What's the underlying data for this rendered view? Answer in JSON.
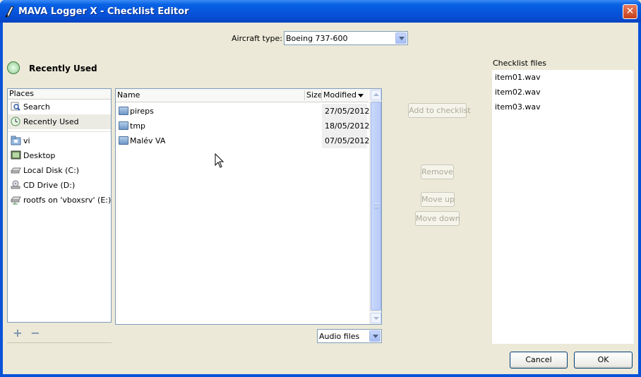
{
  "window": {
    "title": "MAVA Logger X - Checklist Editor",
    "close_glyph": "✕"
  },
  "aircraft": {
    "label": "Aircraft type:",
    "selected": "Boeing 737-600"
  },
  "recent_header": "Recently Used",
  "places": {
    "header": "Places",
    "items": [
      {
        "label": "Search",
        "icon": "search-icon"
      },
      {
        "label": "Recently Used",
        "icon": "recent-icon",
        "selected": true
      },
      {
        "label": "vi",
        "icon": "home-folder-icon"
      },
      {
        "label": "Desktop",
        "icon": "desktop-icon"
      },
      {
        "label": "Local Disk (C:)",
        "icon": "hard-disk-icon"
      },
      {
        "label": "CD Drive (D:)",
        "icon": "cd-drive-icon"
      },
      {
        "label": "rootfs on 'vboxsrv' (E:)",
        "icon": "network-drive-icon"
      }
    ],
    "add_glyph": "+",
    "remove_glyph": "−"
  },
  "files": {
    "columns": {
      "name": "Name",
      "size": "Size",
      "modified": "Modified"
    },
    "rows": [
      {
        "name": "pireps",
        "modified": "27/05/2012"
      },
      {
        "name": "tmp",
        "modified": "18/05/2012"
      },
      {
        "name": "Malév VA",
        "modified": "07/05/2012"
      }
    ]
  },
  "filter": {
    "selected": "Audio files"
  },
  "actions": {
    "add": "Add to checklist",
    "remove": "Remove",
    "move_up": "Move up",
    "move_down": "Move down"
  },
  "checklist": {
    "label": "Checklist files",
    "items": [
      "item01.wav",
      "item02.wav",
      "item03.wav"
    ]
  },
  "buttons": {
    "cancel": "Cancel",
    "ok": "OK"
  }
}
